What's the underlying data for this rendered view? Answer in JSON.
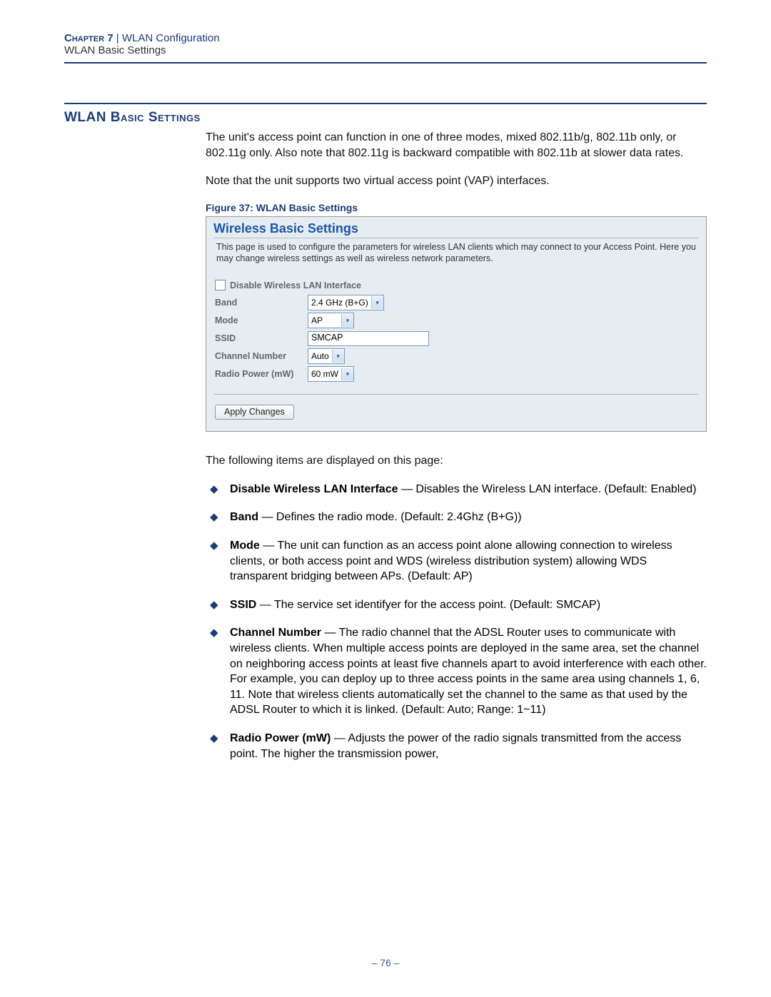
{
  "header": {
    "chapter_label": "Chapter 7",
    "separator": "  |  ",
    "chapter_title": "WLAN Configuration",
    "subtitle": "WLAN Basic Settings"
  },
  "section": {
    "title": "WLAN Basic Settings",
    "p1": "The unit's access point can function in one of three modes, mixed 802.11b/g, 802.11b only, or 802.11g only. Also note that 802.11g is backward compatible with 802.11b at slower data rates.",
    "p2": "Note that the unit supports two virtual access point (VAP) interfaces.",
    "figure_caption": "Figure 37:  WLAN Basic Settings"
  },
  "panel": {
    "title": "Wireless Basic Settings",
    "desc": "This page is used to configure the parameters for wireless LAN clients which may connect to your Access Point. Here you may change wireless settings as well as wireless network parameters.",
    "disable_label": "Disable Wireless LAN Interface",
    "rows": {
      "band_label": "Band",
      "band_value": "2.4 GHz (B+G)",
      "mode_label": "Mode",
      "mode_value": "AP",
      "ssid_label": "SSID",
      "ssid_value": "SMCAP",
      "channel_label": "Channel Number",
      "channel_value": "Auto",
      "power_label": "Radio Power (mW)",
      "power_value": "60 mW"
    },
    "button_label": "Apply Changes"
  },
  "list_intro": "The following items are displayed on this page:",
  "items": [
    {
      "term": "Disable Wireless LAN Interface",
      "desc": " — Disables the Wireless LAN interface. (Default: Enabled)"
    },
    {
      "term": "Band",
      "desc": " — Defines the radio mode. (Default: 2.4Ghz (B+G))"
    },
    {
      "term": "Mode",
      "desc": " — The unit can function as an access point alone allowing connection to wireless clients, or both access point and WDS (wireless distribution system) allowing WDS transparent bridging between APs. (Default: AP)"
    },
    {
      "term": "SSID",
      "desc": " — The service set identifyer for the access point. (Default: SMCAP)"
    },
    {
      "term": "Channel Number",
      "desc": " — The radio channel that the ADSL Router uses to communicate with wireless clients. When multiple access points are deployed in the same area, set the channel on neighboring access points at least five channels apart to avoid interference with each other. For example, you can deploy up to three access points in the same area using channels 1, 6, 11. Note that wireless clients automatically set the channel to the same as that used by the ADSL Router to which it is linked. (Default: Auto; Range: 1~11)"
    },
    {
      "term": "Radio Power (mW)",
      "desc": " — Adjusts the power of the radio signals transmitted from the access point. The higher the transmission power,"
    }
  ],
  "page_number": "–  76  –"
}
